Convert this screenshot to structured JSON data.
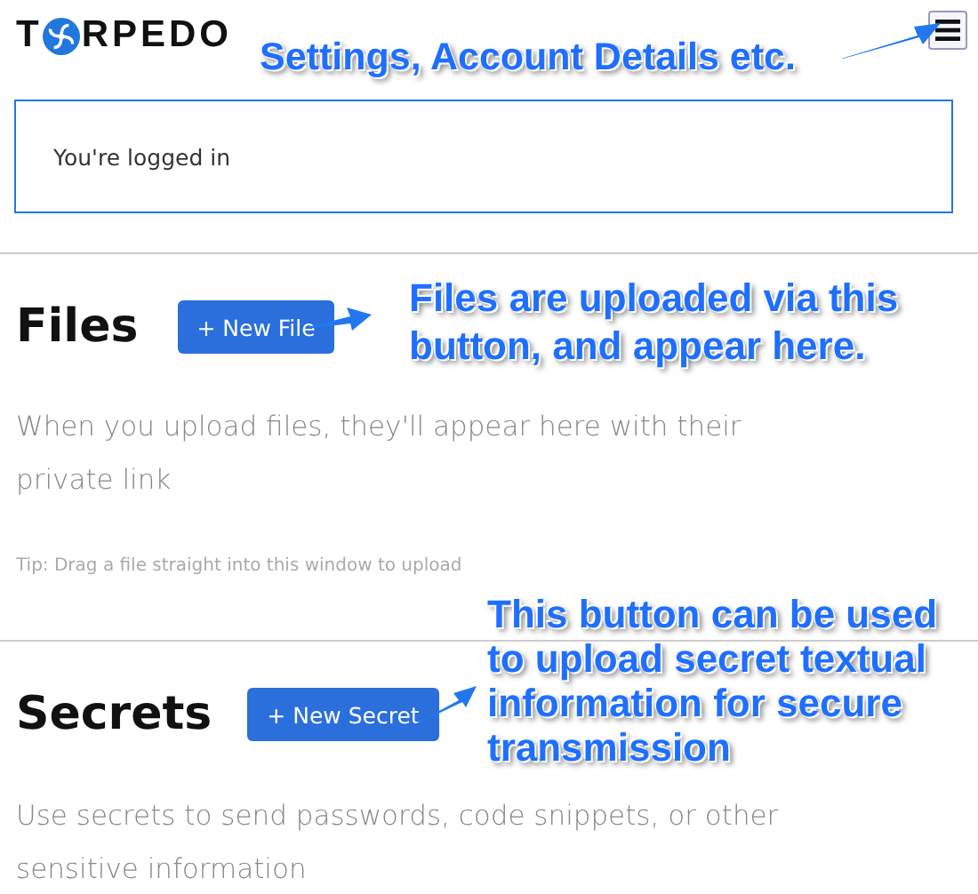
{
  "logo": {
    "before": "T",
    "after": "RPEDO"
  },
  "status": {
    "text": "You're logged in"
  },
  "sections": [
    {
      "title": "Files",
      "button": "+ New File",
      "description": "When you upload files, they'll appear here with their private link",
      "tip": "Tip: Drag a file straight into this window to upload"
    },
    {
      "title": "Secrets",
      "button": "+ New Secret",
      "description": "Use secrets to send passwords, code snippets, or other sensitive information"
    }
  ],
  "annotations": [
    {
      "text": "Settings, Account Details etc."
    },
    {
      "text": "Files are uploaded via this button, and appear here."
    },
    {
      "text": "This button can be used to upload secret textual information for secure transmission"
    }
  ]
}
